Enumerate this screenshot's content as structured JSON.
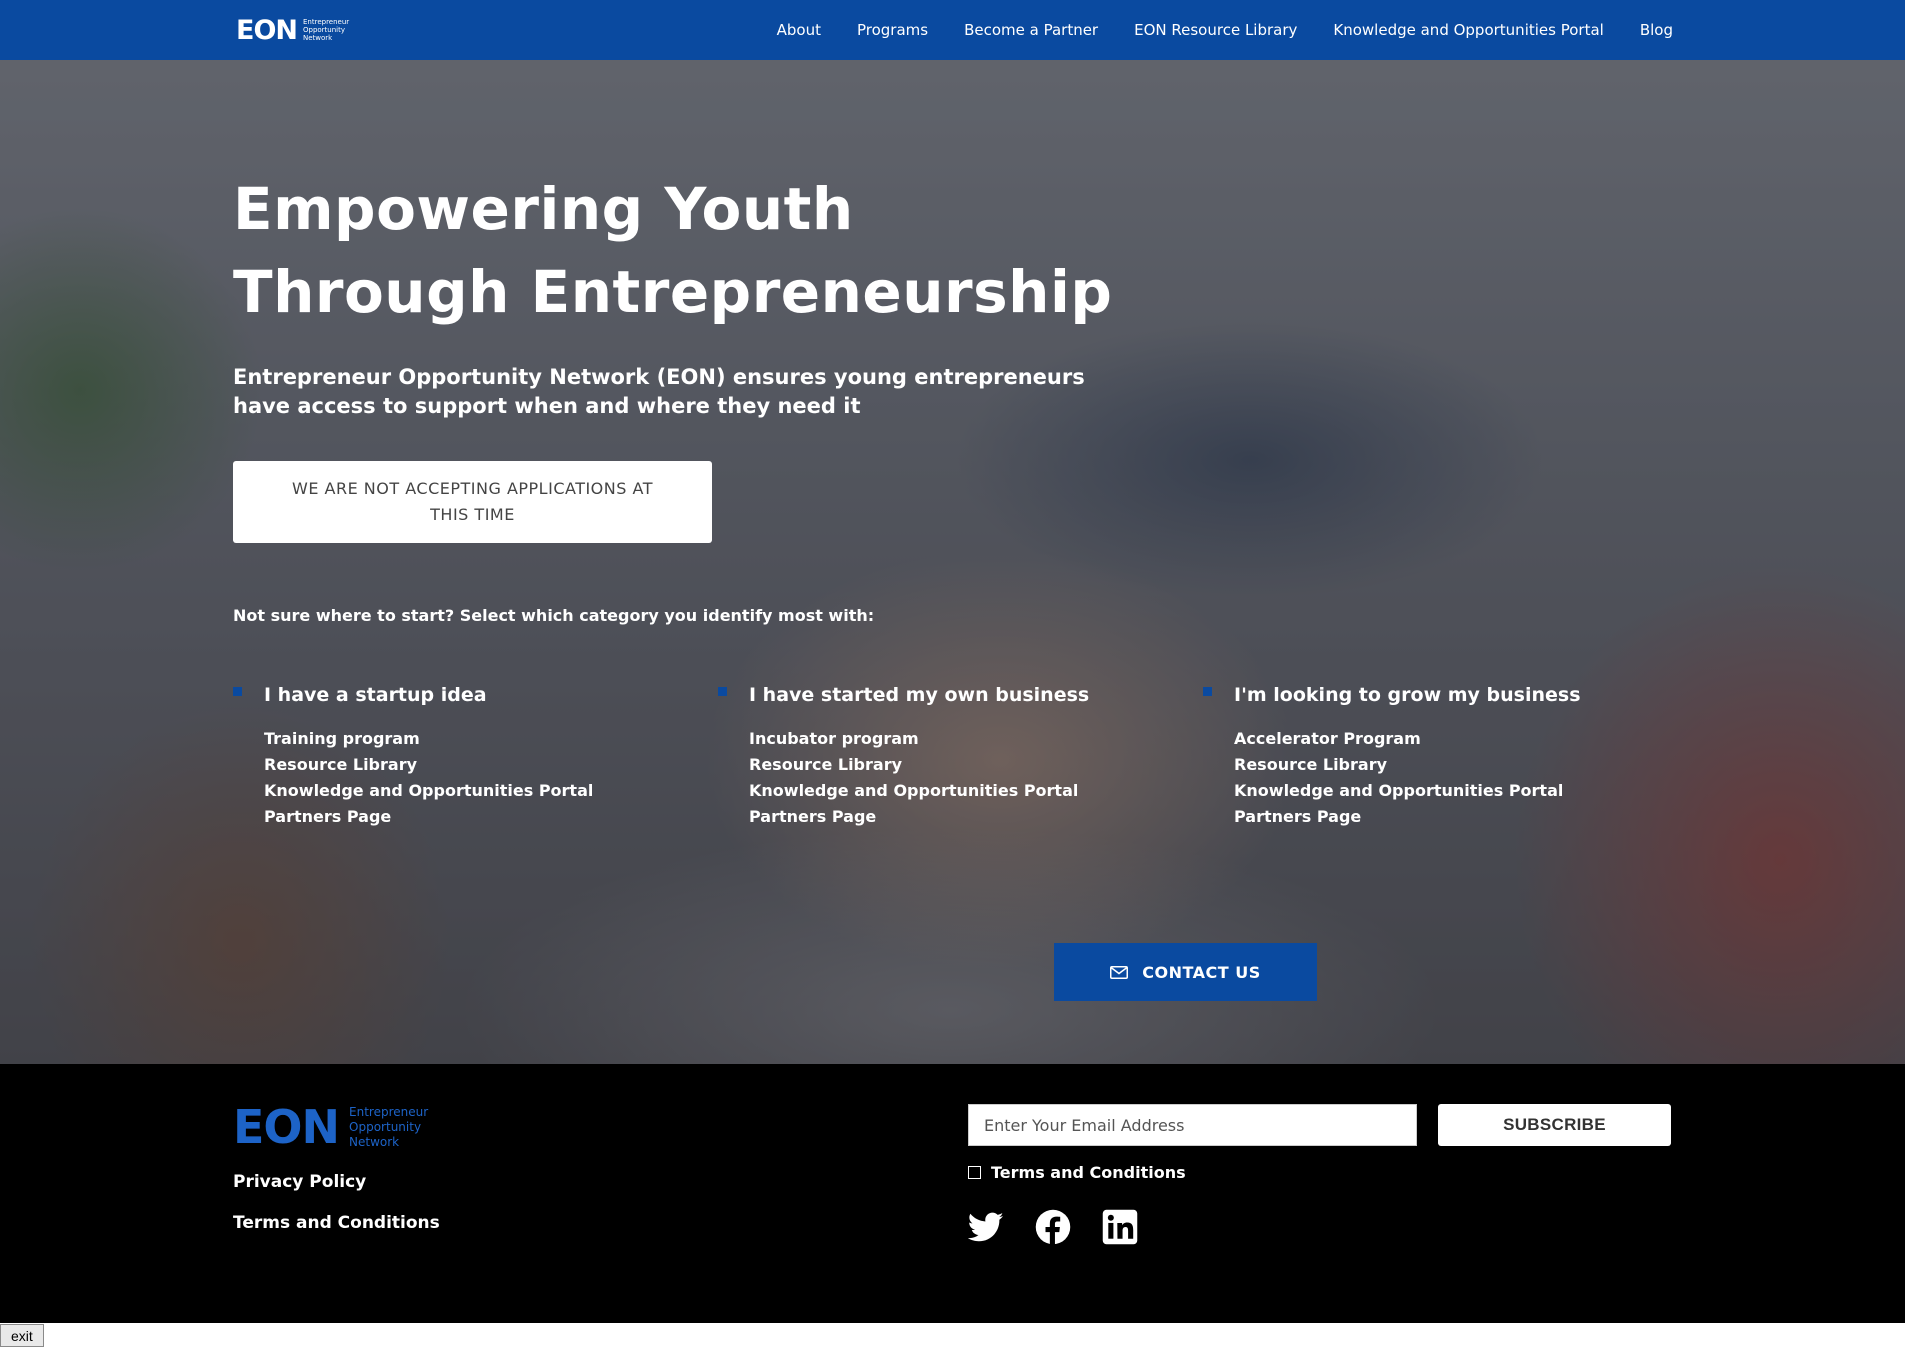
{
  "nav": {
    "logo_mark": "EON",
    "logo_sub": [
      "Entrepreneur",
      "Opportunity",
      "Network"
    ],
    "links": [
      "About",
      "Programs",
      "Become a Partner",
      "EON Resource Library",
      "Knowledge and Opportunities Portal",
      "Blog"
    ]
  },
  "hero": {
    "title_line1": "Empowering Youth",
    "title_line2": "Through Entrepreneurship",
    "subtitle": "Entrepreneur Opportunity Network (EON) ensures young entrepreneurs have access to support when and where they need it",
    "notice": "WE ARE NOT ACCEPTING APPLICATIONS AT THIS TIME",
    "prompt": "Not sure where to start? Select which category you identify most with:",
    "categories": [
      {
        "title": "I have a startup idea",
        "links": [
          "Training program",
          "Resource Library",
          "Knowledge and Opportunities Portal",
          "Partners Page"
        ]
      },
      {
        "title": "I have started my own business",
        "links": [
          "Incubator program",
          "Resource Library",
          "Knowledge and Opportunities Portal",
          "Partners Page"
        ]
      },
      {
        "title": "I'm looking to grow my business",
        "links": [
          "Accelerator Program",
          "Resource Library",
          "Knowledge and Opportunities Portal",
          "Partners Page"
        ]
      }
    ],
    "contact_label": "CONTACT US"
  },
  "footer": {
    "logo_mark": "EON",
    "logo_sub": [
      "Entrepreneur",
      "Opportunity",
      "Network"
    ],
    "privacy": "Privacy Policy",
    "terms": "Terms and Conditions",
    "email_placeholder": "Enter Your Email Address",
    "subscribe": "SUBSCRIBE",
    "terms_check_label": "Terms and Conditions",
    "socials": [
      "twitter-icon",
      "facebook-icon",
      "linkedin-icon"
    ]
  },
  "exit_label": "exit",
  "colors": {
    "brand_blue": "#0a4aa0",
    "logo_blue": "#1d63c7",
    "footer_bg": "#000000"
  }
}
